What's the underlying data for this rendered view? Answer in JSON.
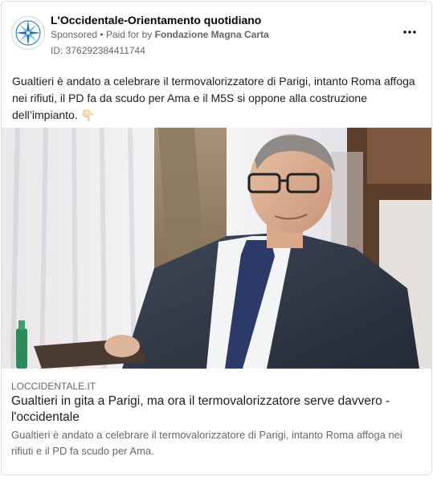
{
  "header": {
    "page_name": "L'Occidentale-Orientamento quotidiano",
    "sponsored": "Sponsored",
    "separator": "•",
    "paid_for_prefix": "Paid for by",
    "paid_for_by": "Fondazione Magna Carta",
    "ad_id": "ID: 376292384411744",
    "more_icon": "more-horizontal-icon"
  },
  "post": {
    "text": "Gualtieri è andato a celebrare il termovalorizzatore di Parigi, intanto Roma affoga nei rifiuti, il PD fa da scudo per Ama e il M5S si oppone alla costruzione dell’impianto. 👇🏻"
  },
  "link": {
    "domain": "LOCCIDENTALE.IT",
    "title": "Gualtieri in gita a Parigi, ma ora il termovalorizzatore serve davvero - l'occidentale",
    "description": "Gualtieri è andato a celebrare il termovalorizzatore di Parigi, intanto Roma affoga nei rifiuti e il PD fa scudo per Ama."
  },
  "colors": {
    "logo_blue": "#1f6fb5",
    "text_secondary": "#65676b",
    "border": "#dadde1"
  }
}
